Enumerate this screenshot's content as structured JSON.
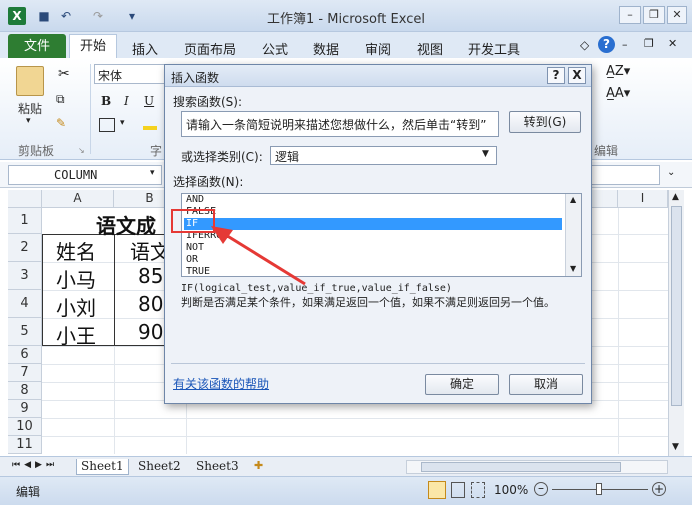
{
  "window": {
    "title": "工作簿1 - Microsoft Excel",
    "app_icon": "X"
  },
  "ribbon_tabs": [
    "文件",
    "开始",
    "插入",
    "页面布局",
    "公式",
    "数据",
    "审阅",
    "视图",
    "开发工具"
  ],
  "ribbon": {
    "font_name": "宋体",
    "paste_label": "粘贴",
    "clipboard_label": "剪贴板",
    "font_group_label": "字",
    "edit_group_label": "编辑",
    "bold": "B",
    "italic": "I",
    "underline": "U"
  },
  "formula_bar": {
    "name_box": "COLUMN"
  },
  "grid": {
    "columns": [
      "A",
      "B",
      "I"
    ],
    "rows": [
      "1",
      "2",
      "3",
      "4",
      "5",
      "6",
      "7",
      "8",
      "9",
      "10",
      "11"
    ],
    "cells": {
      "b1": "语文成",
      "a2": "姓名",
      "b2": "语文",
      "a3": "小马",
      "b3": "85",
      "a4": "小刘",
      "b4": "80",
      "a5": "小王",
      "b5": "90"
    }
  },
  "sheets": [
    "Sheet1",
    "Sheet2",
    "Sheet3"
  ],
  "status": {
    "mode": "编辑",
    "zoom": "100%"
  },
  "dialog": {
    "title": "插入函数",
    "help_btn": "?",
    "close_btn": "X",
    "search_label": "搜索函数(S):",
    "search_value": "请输入一条简短说明来描述您想做什么，然后单击“转到”",
    "goto_btn": "转到(G)",
    "category_label": "或选择类别(C):",
    "category_value": "逻辑",
    "select_label": "选择函数(N):",
    "functions": [
      "AND",
      "FALSE",
      "IF",
      "IFERROR",
      "NOT",
      "OR",
      "TRUE"
    ],
    "selected_function": "IF",
    "signature": "IF(logical_test,value_if_true,value_if_false)",
    "description": "判断是否满足某个条件，如果满足返回一个值，如果不满足则返回另一个值。",
    "help_link": "有关该函数的帮助",
    "ok_btn": "确定",
    "cancel_btn": "取消"
  },
  "annotation_color": "#e53935",
  "selection_color": "#3399ff"
}
